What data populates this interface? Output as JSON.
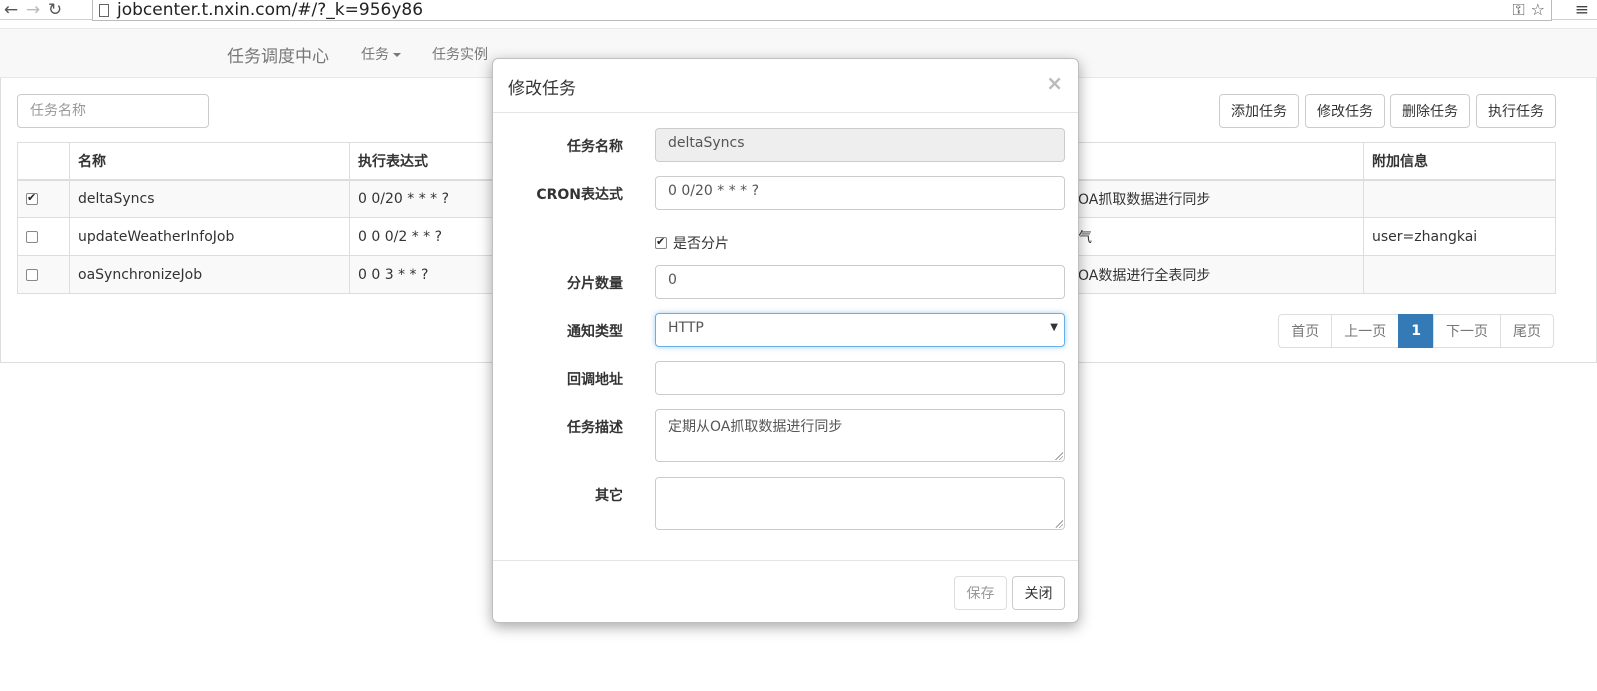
{
  "browser": {
    "url": "jobcenter.t.nxin.com/#/?_k=956y86"
  },
  "navbar": {
    "brand": "任务调度中心",
    "links": [
      "任务",
      "任务实例"
    ]
  },
  "toolbar": {
    "search_placeholder": "任务名称",
    "add": "添加任务",
    "edit": "修改任务",
    "delete": "删除任务",
    "run": "执行任务"
  },
  "table": {
    "headers": [
      "",
      "名称",
      "执行表达式",
      "",
      "附加信息"
    ],
    "rows": [
      {
        "checked": true,
        "name": "deltaSyncs",
        "cron": "0 0/20 * * * ?",
        "desc": "OA抓取数据进行同步",
        "extra": ""
      },
      {
        "checked": false,
        "name": "updateWeatherInfoJob",
        "cron": "0 0 0/2 * * ?",
        "desc": "气",
        "extra": "user=zhangkai"
      },
      {
        "checked": false,
        "name": "oaSynchronizeJob",
        "cron": "0 0 3 * * ?",
        "desc": "OA数据进行全表同步",
        "extra": ""
      }
    ]
  },
  "pagination": {
    "first": "首页",
    "prev": "上一页",
    "current": "1",
    "next": "下一页",
    "last": "尾页"
  },
  "modal": {
    "title": "修改任务",
    "close": "×",
    "fields": {
      "name_label": "任务名称",
      "name_value": "deltaSyncs",
      "cron_label": "CRON表达式",
      "cron_value": "0 0/20 * * * ?",
      "shard_label": "是否分片",
      "shard_checked": true,
      "shard_count_label": "分片数量",
      "shard_count_value": "0",
      "notify_label": "通知类型",
      "notify_value": "HTTP",
      "callback_label": "回调地址",
      "callback_value": "",
      "desc_label": "任务描述",
      "desc_value": "定期从OA抓取数据进行同步",
      "other_label": "其它",
      "other_value": ""
    },
    "save": "保存",
    "close_btn": "关闭"
  }
}
